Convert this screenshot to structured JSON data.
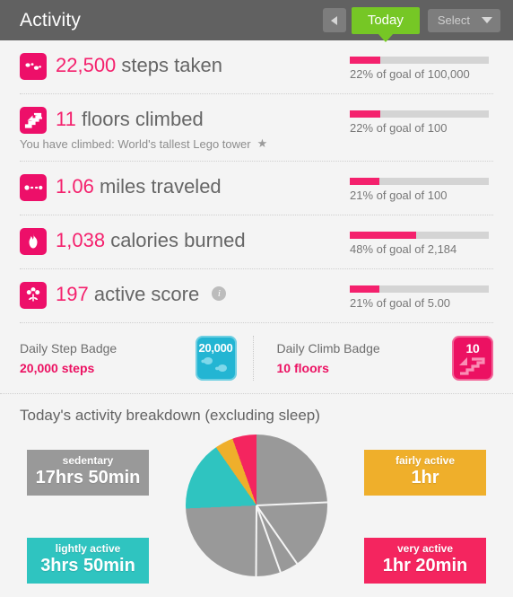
{
  "header": {
    "title": "Activity",
    "prev_icon": "caret-left-icon",
    "today_label": "Today",
    "select_label": "Select",
    "select_caret_icon": "chevron-down-icon",
    "today_bg": "#76c725",
    "bar_bg": "#616161"
  },
  "stats": {
    "accent": "#f4216d",
    "rows": [
      {
        "icon": "footsteps-icon",
        "value": "22,500",
        "label": "steps taken",
        "subtitle": null,
        "percent": 22,
        "goal_text": "22% of goal of 100,000",
        "has_info": false
      },
      {
        "icon": "stairs-icon",
        "value": "11",
        "label": "floors climbed",
        "subtitle": "You have climbed: World's tallest Lego tower",
        "subtitle_icon": "star-icon",
        "percent": 22,
        "goal_text": "22% of goal of 100",
        "has_info": false
      },
      {
        "icon": "distance-icon",
        "value": "1.06",
        "label": "miles traveled",
        "subtitle": null,
        "percent": 21,
        "goal_text": "21% of goal of 100",
        "has_info": false
      },
      {
        "icon": "flame-icon",
        "value": "1,038",
        "label": "calories burned",
        "subtitle": null,
        "percent": 48,
        "goal_text": "48% of goal of 2,184",
        "has_info": false
      },
      {
        "icon": "flower-icon",
        "value": "197",
        "label": "active score",
        "subtitle": null,
        "percent": 21,
        "goal_text": "21% of goal of 5.00",
        "has_info": true,
        "info_icon": "info-icon"
      }
    ]
  },
  "badges": [
    {
      "name": "Daily Step Badge",
      "value": "20,000 steps",
      "icon": "step-badge-icon",
      "icon_text": "20,000",
      "color": "#23b5d3"
    },
    {
      "name": "Daily Climb Badge",
      "value": "10 floors",
      "icon": "climb-badge-icon",
      "icon_text": "10",
      "color": "#ec1162"
    }
  ],
  "breakdown": {
    "title": "Today's activity breakdown (excluding sleep)",
    "chips": {
      "sedentary": {
        "label": "sedentary",
        "value": "17hrs 50min"
      },
      "lightly": {
        "label": "lightly active",
        "value": "3hrs 50min"
      },
      "fairly": {
        "label": "fairly active",
        "value": "1hr"
      },
      "very": {
        "label": "very active",
        "value": "1hr 20min"
      }
    }
  },
  "chart_data": {
    "type": "pie",
    "title": "Today's activity breakdown (excluding sleep)",
    "labels": [
      "sedentary",
      "lightly active",
      "fairly active",
      "very active"
    ],
    "display_values": [
      "17hrs 50min",
      "3hrs 50min",
      "1hr",
      "1hr 20min"
    ],
    "values_minutes": [
      1070,
      230,
      60,
      80
    ],
    "percentages": [
      74.3,
      16.0,
      4.2,
      5.6
    ],
    "colors": [
      "#999999",
      "#2fc4c0",
      "#efaf2b",
      "#f4255f"
    ],
    "start_angle_deg": 0,
    "direction": "clockwise",
    "legend": "side-chips",
    "total_minutes": 1440
  }
}
